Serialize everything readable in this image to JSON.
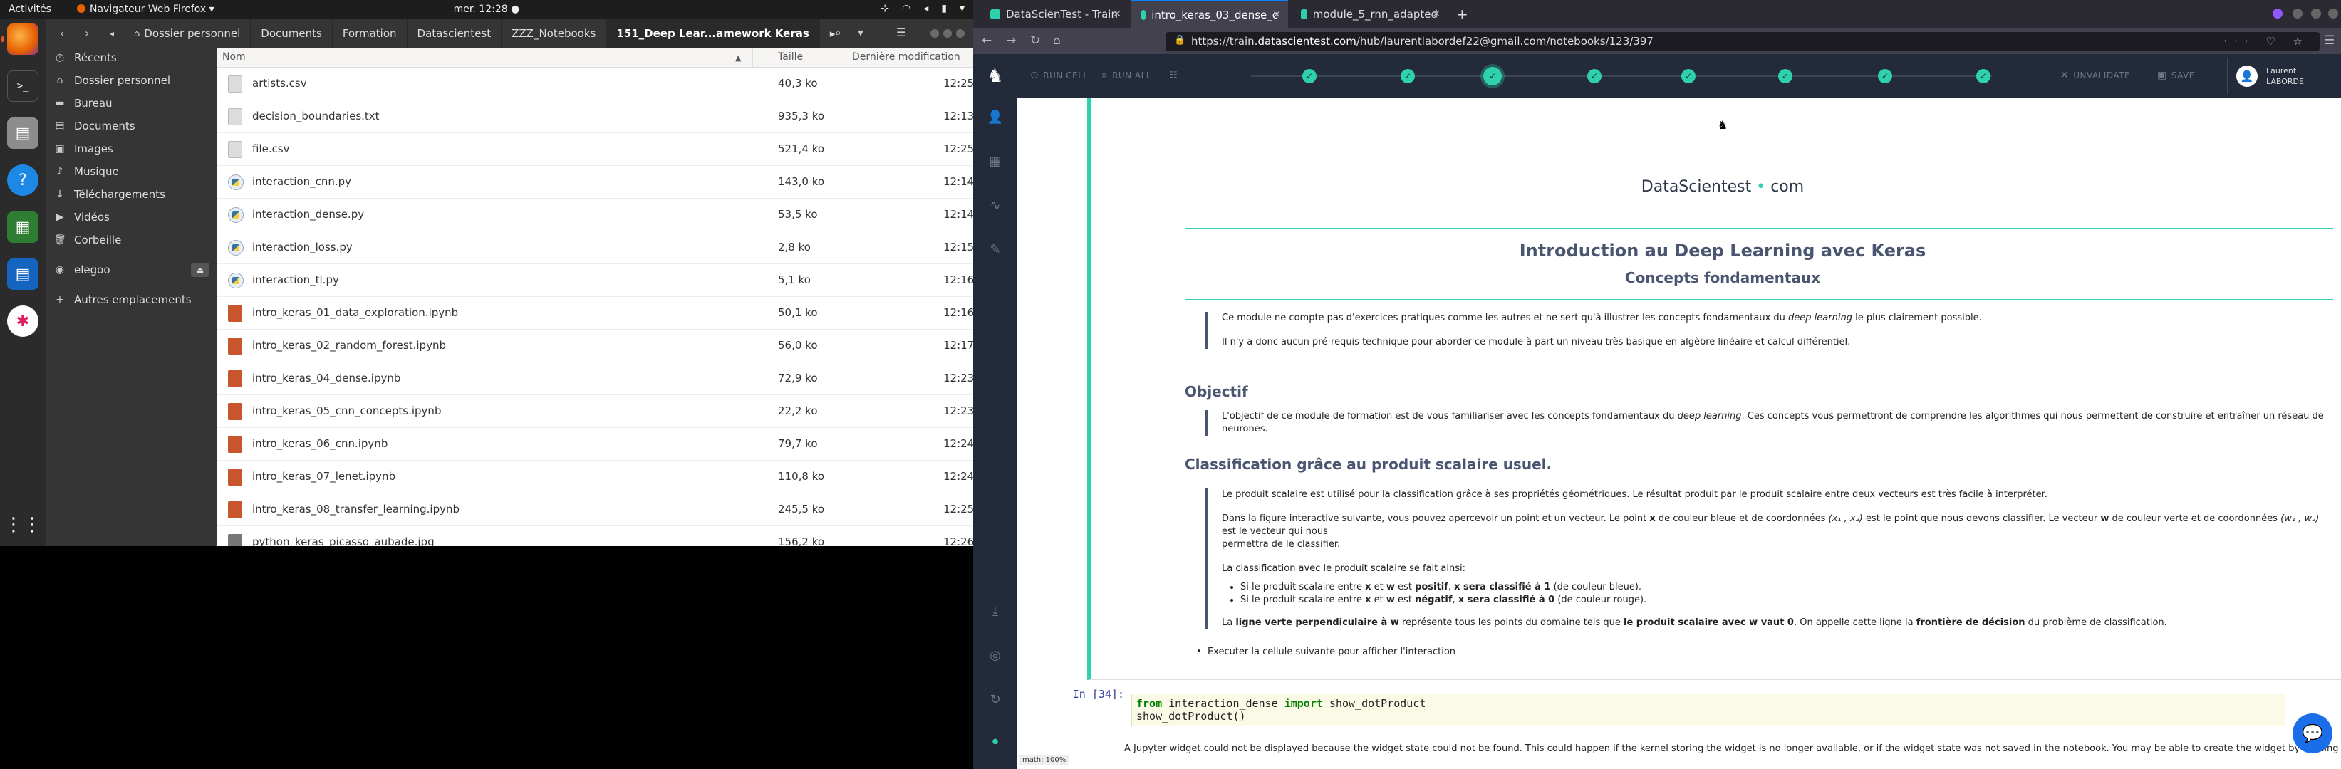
{
  "topbar": {
    "activities": "Activités",
    "app": "Navigateur Web Firefox ▾",
    "clock": "mer. 12:28 ●"
  },
  "files": {
    "breadcrumbs": [
      "Dossier personnel",
      "Documents",
      "Formation",
      "Datascientest",
      "ZZZ_Notebooks",
      "151_Deep Lear...amework Keras"
    ],
    "places": [
      {
        "icon": "clock-icon",
        "glyph": "◷",
        "label": "Récents"
      },
      {
        "icon": "home-icon",
        "glyph": "⌂",
        "label": "Dossier personnel"
      },
      {
        "icon": "folder-icon",
        "glyph": "▬",
        "label": "Bureau"
      },
      {
        "icon": "documents-icon",
        "glyph": "▤",
        "label": "Documents"
      },
      {
        "icon": "images-icon",
        "glyph": "▣",
        "label": "Images"
      },
      {
        "icon": "music-icon",
        "glyph": "♪",
        "label": "Musique"
      },
      {
        "icon": "download-icon",
        "glyph": "↓",
        "label": "Téléchargements"
      },
      {
        "icon": "video-icon",
        "glyph": "▶",
        "label": "Vidéos"
      },
      {
        "icon": "trash-icon",
        "glyph": "🗑",
        "label": "Corbeille"
      },
      {
        "icon": "drive-icon",
        "glyph": "◉",
        "label": "elegoo"
      },
      {
        "icon": "plus-icon",
        "glyph": "+",
        "label": "Autres emplacements"
      }
    ],
    "columns": {
      "name": "Nom",
      "size": "Taille",
      "modified": "Dernière modification"
    },
    "rows": [
      {
        "type": "doc",
        "name": "artists.csv",
        "size": "40,3 ko",
        "time": "12:25"
      },
      {
        "type": "doc",
        "name": "decision_boundaries.txt",
        "size": "935,3 ko",
        "time": "12:13"
      },
      {
        "type": "doc",
        "name": "file.csv",
        "size": "521,4 ko",
        "time": "12:25"
      },
      {
        "type": "py",
        "name": "interaction_cnn.py",
        "size": "143,0 ko",
        "time": "12:14"
      },
      {
        "type": "py",
        "name": "interaction_dense.py",
        "size": "53,5 ko",
        "time": "12:14"
      },
      {
        "type": "py",
        "name": "interaction_loss.py",
        "size": "2,8 ko",
        "time": "12:15"
      },
      {
        "type": "py",
        "name": "interaction_tl.py",
        "size": "5,1 ko",
        "time": "12:16"
      },
      {
        "type": "nb",
        "name": "intro_keras_01_data_exploration.ipynb",
        "size": "50,1 ko",
        "time": "12:16"
      },
      {
        "type": "nb",
        "name": "intro_keras_02_random_forest.ipynb",
        "size": "56,0 ko",
        "time": "12:17"
      },
      {
        "type": "nb",
        "name": "intro_keras_04_dense.ipynb",
        "size": "72,9 ko",
        "time": "12:23"
      },
      {
        "type": "nb",
        "name": "intro_keras_05_cnn_concepts.ipynb",
        "size": "22,2 ko",
        "time": "12:23"
      },
      {
        "type": "nb",
        "name": "intro_keras_06_cnn.ipynb",
        "size": "79,7 ko",
        "time": "12:24"
      },
      {
        "type": "nb",
        "name": "intro_keras_07_lenet.ipynb",
        "size": "110,8 ko",
        "time": "12:24"
      },
      {
        "type": "nb",
        "name": "intro_keras_08_transfer_learning.ipynb",
        "size": "245,5 ko",
        "time": "12:25"
      },
      {
        "type": "img",
        "name": "python_keras_picasso_aubade.jpg",
        "size": "156,2 ko",
        "time": "12:26"
      }
    ]
  },
  "browser": {
    "tabs": [
      {
        "label": "DataScienTest - Train",
        "active": false,
        "color": "#2fd0ae"
      },
      {
        "label": "intro_keras_03_dense_c",
        "active": true,
        "color": "#2fd0ae"
      },
      {
        "label": "module_5_rnn_adapted",
        "active": false,
        "color": "#2fd0ae"
      }
    ],
    "url_prefix": "https://train.",
    "url_domain": "datascientest.com",
    "url_path": "/hub/laurentlabordef22@gmail.com/notebooks/123/397",
    "url_right": "··· ♡ ☆"
  },
  "ds": {
    "tools": {
      "run_cell": "RUN CELL",
      "run_all": "RUN ALL",
      "validate": "UNVALIDATE",
      "save": "SAVE"
    },
    "user": {
      "first": "Laurent",
      "last": "LABORDE"
    },
    "brand_name": "DataScientest",
    "brand_sep": "•",
    "brand_tld": "com",
    "title": "Introduction au Deep Learning avec Keras",
    "subtitle": "Concepts fondamentaux",
    "intro_p1_a": "Ce module ne compte pas d'exercices pratiques comme les autres et ne sert qu'à illustrer les concepts fondamentaux du ",
    "intro_p1_em": "deep learning",
    "intro_p1_b": " le plus clairement possible.",
    "intro_p2": "Il n'y a donc aucun pré-requis technique pour aborder ce module à part un niveau très basique en algèbre linéaire et calcul différentiel.",
    "objectif_title": "Objectif",
    "objectif_a": "L'objectif de ce module de formation est de vous familiariser avec les concepts fondamentaux du ",
    "objectif_em": "deep learning",
    "objectif_b": ". Ces concepts vous permettront de comprendre les algorithmes qui nous permettent de construire et entraîner un réseau de neurones.",
    "classif_title": "Classification grâce au produit scalaire usuel.",
    "classif_p1": "Le produit scalaire est utilisé pour la classification grâce à ses propriétés géométriques. Le résultat produit par le produit scalaire entre deux vecteurs est très facile à interpréter.",
    "classif_p2_a": "Dans la figure interactive suivante, vous pouvez apercevoir un point et un vecteur. Le point ",
    "classif_p2_x": "x",
    "classif_p2_b": " de couleur bleue et de coordonnées ",
    "classif_p2_xc": "(x₁ , x₂)",
    "classif_p2_c": " est le point que nous devons classifier. Le vecteur ",
    "classif_p2_w": "w",
    "classif_p2_d": " de couleur verte et de coordonnées ",
    "classif_p2_wc": "(w₁ , w₂)",
    "classif_p2_e": " est le vecteur qui nous",
    "classif_p2_f": "permettra de le classifier.",
    "classif_p3": "La classification avec le produit scalaire se fait ainsi:",
    "li1_a": "Si le produit scalaire entre ",
    "li1_x": "x",
    "li1_b": " et ",
    "li1_w": "w",
    "li1_c": " est ",
    "li1_pos": "positif",
    "li1_d": ", ",
    "li1_cls": "x sera classifié à 1",
    "li1_e": " (de couleur bleue).",
    "li2_a": "Si le produit scalaire entre ",
    "li2_x": "x",
    "li2_b": " et ",
    "li2_w": "w",
    "li2_c": " est ",
    "li2_neg": "négatif",
    "li2_d": ", ",
    "li2_cls": "x sera classifié à 0",
    "li2_e": " (de couleur rouge).",
    "classif_p4_a": "La ",
    "classif_p4_b": "ligne verte perpendiculaire à w",
    "classif_p4_c": " représente tous les points du domaine tels que ",
    "classif_p4_d": "le produit scalaire avec w vaut 0",
    "classif_p4_e": ". On appelle cette ligne la ",
    "classif_p4_f": "frontière de décision",
    "classif_p4_g": " du problème de classification.",
    "exec_bullet": "Executer la cellule suivante pour afficher l'interaction",
    "prompt": "In [34]:",
    "code_kw1": "from",
    "code_mod": " interaction_dense ",
    "code_kw2": "import",
    "code_fn": " show_dotProduct",
    "code_line2": "show_dotProduct()",
    "widget_msg": "A Jupyter widget could not be displayed because the widget state could not be found. This could happen if the kernel storing the widget is no longer available, or if the widget state was not saved in the notebook. You may be able to create the widget by running the appropriate cells.",
    "math_badge": "math: 100%"
  }
}
